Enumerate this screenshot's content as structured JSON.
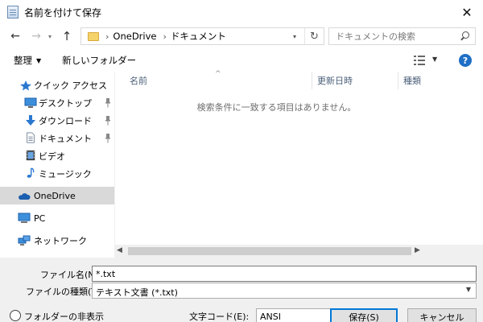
{
  "window": {
    "title": "名前を付けて保存",
    "close_glyph": "✕"
  },
  "nav": {
    "back_glyph": "←",
    "forward_glyph": "→",
    "recent_glyph": "▾",
    "up_glyph": "↑",
    "breadcrumb": [
      "OneDrive",
      "ドキュメント"
    ],
    "crumb_sep": "›",
    "refresh_glyph": "↻",
    "search_placeholder": "ドキュメントの検索"
  },
  "toolbar": {
    "organize_label": "整理",
    "organize_caret": "▼",
    "new_folder_label": "新しいフォルダー",
    "view_caret": "▼",
    "help_glyph": "?"
  },
  "sidebar": {
    "items": [
      {
        "label": "クイック アクセス",
        "icon": "star-icon",
        "pinned": false
      },
      {
        "label": "デスクトップ",
        "icon": "desktop-icon",
        "pinned": true
      },
      {
        "label": "ダウンロード",
        "icon": "download-icon",
        "pinned": true
      },
      {
        "label": "ドキュメント",
        "icon": "document-icon",
        "pinned": true
      },
      {
        "label": "ビデオ",
        "icon": "video-icon",
        "pinned": false
      },
      {
        "label": "ミュージック",
        "icon": "music-icon",
        "pinned": false
      },
      {
        "label": "OneDrive",
        "icon": "cloud-icon",
        "selected": true
      },
      {
        "label": "PC",
        "icon": "computer-icon"
      },
      {
        "label": "ネットワーク",
        "icon": "network-icon"
      }
    ],
    "pin_glyph": "📌"
  },
  "filelist": {
    "columns": [
      "名前",
      "更新日時",
      "種類"
    ],
    "sort_glyph": "^",
    "empty_message": "検索条件に一致する項目はありません。"
  },
  "form": {
    "filename_label": "ファイル名(N):",
    "filename_value": "*.txt",
    "filetype_label": "ファイルの種類(T):",
    "filetype_value": "テキスト文書 (*.txt)",
    "select_caret": "⌄",
    "hide_folders_label": "フォルダーの非表示",
    "encoding_label": "文字コード(E):",
    "encoding_value": "ANSI",
    "save_label": "保存(S)",
    "cancel_label": "キャンセル"
  },
  "colors": {
    "accent": "#0078d7",
    "selected_row": "#d9d9d9",
    "help": "#1e6fc5"
  }
}
